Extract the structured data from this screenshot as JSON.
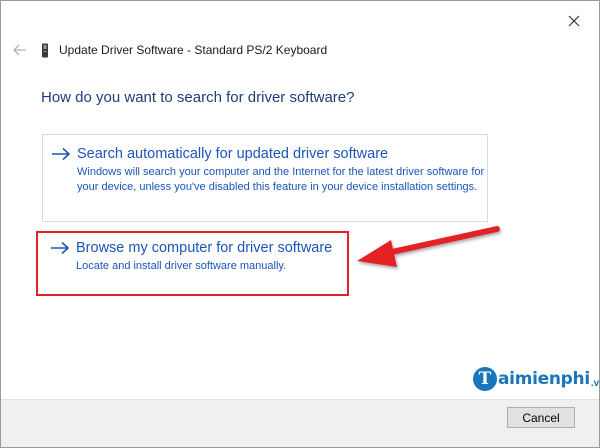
{
  "window": {
    "title": "Update Driver Software - Standard PS/2 Keyboard",
    "back_icon": "back-arrow-icon",
    "close_icon": "close-icon",
    "device_icon": "keyboard-device-icon"
  },
  "main": {
    "question": "How do you want to search for driver software?",
    "options": [
      {
        "title": "Search automatically for updated driver software",
        "description": "Windows will search your computer and the Internet for the latest driver software for your device, unless you've disabled this feature in your device installation settings.",
        "icon": "arrow-right-icon"
      },
      {
        "title": "Browse my computer for driver software",
        "description": "Locate and install driver software manually.",
        "icon": "arrow-right-icon"
      }
    ]
  },
  "annotation": {
    "highlight_color": "#e42226",
    "arrow_icon": "red-pointer-arrow-icon"
  },
  "watermark": {
    "logo_letter": "T",
    "text": "aimienphi",
    "suffix": ".vn"
  },
  "footer": {
    "cancel_label": "Cancel"
  },
  "colors": {
    "link_blue": "#1a56b8",
    "heading_blue": "#1f3d7a",
    "footer_bg": "#f0f0f0"
  }
}
